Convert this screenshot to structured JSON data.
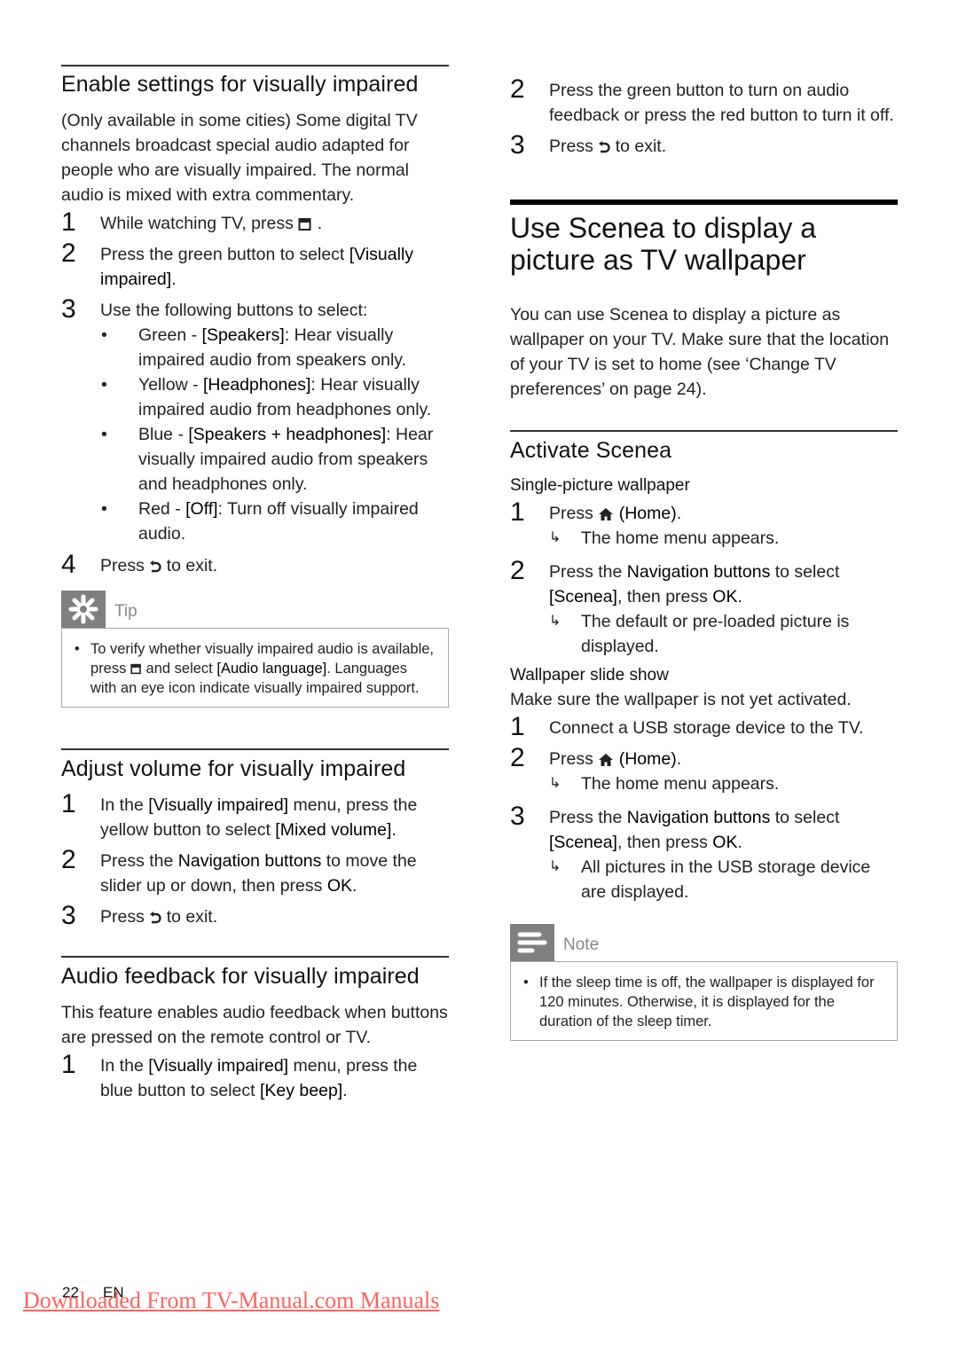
{
  "left": {
    "enable": {
      "heading": "Enable settings for visually impaired",
      "intro": "(Only available in some cities) Some digital TV channels broadcast special audio adapted for people who are visually impaired. The normal audio is mixed with extra commentary.",
      "step1": {
        "num": "1",
        "text": "While watching TV, press",
        "end": "."
      },
      "step2": {
        "num": "2",
        "pre": "Press the green button to select ",
        "ui": "[Visually impaired]",
        "end": "."
      },
      "step3": {
        "num": "3",
        "text": "Use the following buttons to select:"
      },
      "bullets": [
        {
          "pre": "Green - ",
          "ui": "[Speakers]",
          "post": ": Hear visually impaired audio from speakers only."
        },
        {
          "pre": "Yellow - ",
          "ui": "[Headphones]",
          "post": ": Hear visually impaired audio from headphones only."
        },
        {
          "pre": "Blue - ",
          "ui": "[Speakers + headphones]",
          "post": ": Hear visually impaired audio from speakers and headphones only."
        },
        {
          "pre": "Red - ",
          "ui": "[Off]",
          "post": ": Turn off visually impaired audio."
        }
      ],
      "step4": {
        "num": "4",
        "pre": "Press",
        "post": "to exit."
      }
    },
    "tip": {
      "label": "Tip",
      "pre": "To verify whether visually impaired audio is available, press",
      "mid": "and select ",
      "ui": "[Audio language]",
      "post": ". Languages with an eye icon indicate visually impaired support."
    },
    "adjust": {
      "heading": "Adjust volume for visually impaired",
      "step1": {
        "num": "1",
        "pre": "In the ",
        "ui1": "[Visually impaired]",
        "mid": " menu, press the yellow button to select ",
        "ui2": "[Mixed volume]",
        "end": "."
      },
      "step2": {
        "num": "2",
        "pre": "Press the ",
        "ui": "Navigation buttons",
        "post": " to move the slider up or down, then press ",
        "ui2": "OK",
        "end": "."
      },
      "step3": {
        "num": "3",
        "pre": "Press",
        "post": "to exit."
      }
    },
    "feedback": {
      "heading": "Audio feedback for visually impaired",
      "intro": "This feature enables audio feedback when buttons are pressed on the remote control or TV.",
      "step1": {
        "num": "1",
        "pre": "In the ",
        "ui1": "[Visually impaired]",
        "mid": " menu, press the blue button to select ",
        "ui2": "[Key beep]",
        "end": "."
      }
    }
  },
  "right": {
    "feedback_cont": {
      "step2": {
        "num": "2",
        "text": "Press the green button to turn on audio feedback or press the red button to turn it off."
      },
      "step3": {
        "num": "3",
        "pre": "Press",
        "post": "to exit."
      }
    },
    "scenea": {
      "heading": "Use Scenea to display a picture as TV wallpaper",
      "intro": "You can use Scenea to display a picture as wallpaper on your TV. Make sure that the location of your TV is set to home (see ‘Change TV preferences’ on page 24).",
      "activate_heading": "Activate Scenea",
      "single": {
        "subheading": "Single-picture wallpaper",
        "step1": {
          "num": "1",
          "pre": "Press",
          "ui": "(Home)",
          "end": ".",
          "result": "The home menu appears."
        },
        "step2": {
          "num": "2",
          "pre": "Press the ",
          "ui": "Navigation buttons",
          "mid": " to select ",
          "ui2": "[Scenea]",
          "post": ", then press ",
          "ui3": "OK",
          "end": ".",
          "result": "The default or pre-loaded picture is displayed."
        }
      },
      "slideshow": {
        "subheading": "Wallpaper slide show",
        "intro": "Make sure the wallpaper is not yet activated.",
        "step1": {
          "num": "1",
          "text": "Connect a USB storage device to the TV."
        },
        "step2": {
          "num": "2",
          "pre": "Press",
          "ui": "(Home)",
          "end": ".",
          "result": "The home menu appears."
        },
        "step3": {
          "num": "3",
          "pre": "Press the ",
          "ui": "Navigation buttons",
          "mid": " to select ",
          "ui2": "[Scenea]",
          "post": ", then press ",
          "ui3": "OK",
          "end": ".",
          "result": "All pictures in the USB storage device are displayed."
        }
      }
    },
    "note": {
      "label": "Note",
      "text": "If the sleep time is off, the wallpaper is displayed for 120 minutes. Otherwise, it is displayed for the duration of the sleep timer."
    }
  },
  "footer": {
    "page_number": "22",
    "language": "EN",
    "download_link": "Downloaded From TV-Manual.com Manuals"
  }
}
